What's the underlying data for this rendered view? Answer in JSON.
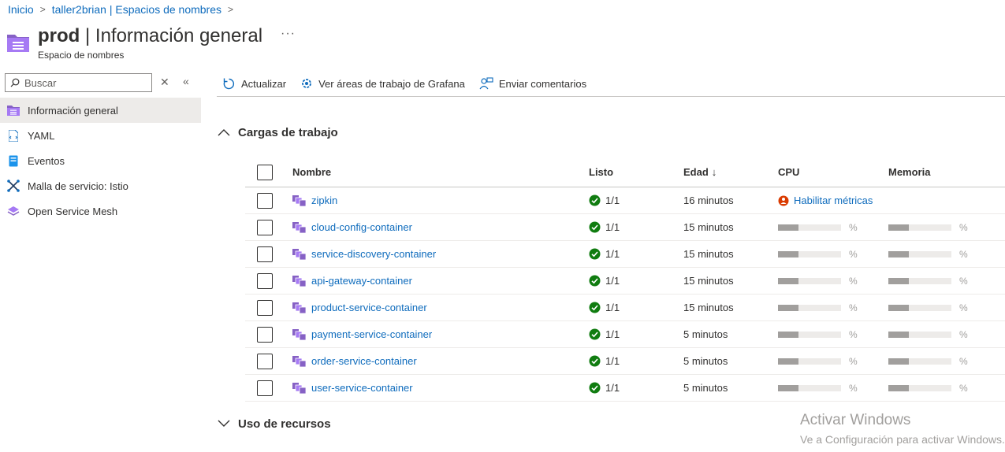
{
  "breadcrumb": [
    {
      "label": "Inicio"
    },
    {
      "label": "taller2brian | Espacios de nombres"
    }
  ],
  "header": {
    "title_bold": "prod",
    "title_rest": " | Información general",
    "subtitle": "Espacio de nombres",
    "more": "···"
  },
  "search": {
    "placeholder": "Buscar"
  },
  "sidebar": {
    "items": [
      {
        "label": "Información general",
        "icon": "namespace-icon"
      },
      {
        "label": "YAML",
        "icon": "yaml-icon"
      },
      {
        "label": "Eventos",
        "icon": "events-icon"
      },
      {
        "label": "Malla de servicio: Istio",
        "icon": "istio-icon"
      },
      {
        "label": "Open Service Mesh",
        "icon": "osm-icon"
      }
    ]
  },
  "toolbar": {
    "refresh": "Actualizar",
    "grafana": "Ver áreas de trabajo de Grafana",
    "feedback": "Enviar comentarios"
  },
  "workloads": {
    "title": "Cargas de trabajo",
    "columns": {
      "name": "Nombre",
      "ready": "Listo",
      "age": "Edad",
      "age_sort": "↓",
      "cpu": "CPU",
      "memory": "Memoria"
    },
    "enable_metrics": "Habilitar métricas",
    "pct": "%",
    "rows": [
      {
        "name": "zipkin",
        "ready": "1/1",
        "age": "16 minutos",
        "metrics": false
      },
      {
        "name": "cloud-config-container",
        "ready": "1/1",
        "age": "15 minutos",
        "metrics": true,
        "cpu": 0.33,
        "mem": 0.33
      },
      {
        "name": "service-discovery-container",
        "ready": "1/1",
        "age": "15 minutos",
        "metrics": true,
        "cpu": 0.33,
        "mem": 0.33
      },
      {
        "name": "api-gateway-container",
        "ready": "1/1",
        "age": "15 minutos",
        "metrics": true,
        "cpu": 0.33,
        "mem": 0.33
      },
      {
        "name": "product-service-container",
        "ready": "1/1",
        "age": "15 minutos",
        "metrics": true,
        "cpu": 0.33,
        "mem": 0.33
      },
      {
        "name": "payment-service-container",
        "ready": "1/1",
        "age": "5 minutos",
        "metrics": true,
        "cpu": 0.33,
        "mem": 0.33
      },
      {
        "name": "order-service-container",
        "ready": "1/1",
        "age": "5 minutos",
        "metrics": true,
        "cpu": 0.33,
        "mem": 0.33
      },
      {
        "name": "user-service-container",
        "ready": "1/1",
        "age": "5 minutos",
        "metrics": true,
        "cpu": 0.33,
        "mem": 0.33
      }
    ]
  },
  "resources": {
    "title": "Uso de recursos"
  },
  "watermark": {
    "line1": "Activar Windows",
    "line2": "Ve a Configuración para activar Windows."
  },
  "colors": {
    "link": "#0f6cbd",
    "ok": "#107c10",
    "warn": "#da3b01",
    "accent": "#8661c5"
  }
}
